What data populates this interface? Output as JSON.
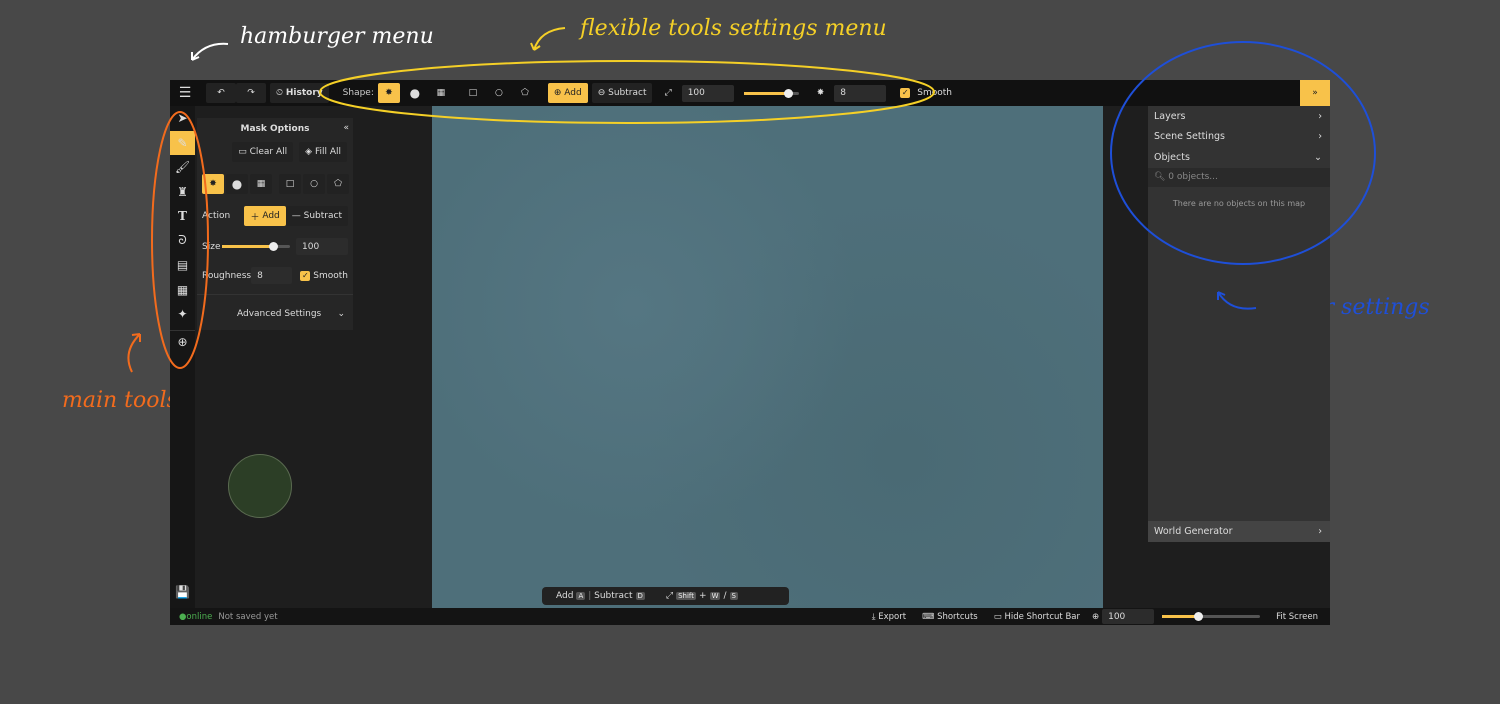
{
  "annotations": {
    "hamburger": "hamburger menu",
    "flexible": "flexible tools settings menu",
    "main_tools": "main tools menu",
    "layer": "layer settings"
  },
  "colors": {
    "accent": "#f8c24a",
    "map": "#4e6f7a",
    "annotation_yellow": "#f5d027",
    "annotation_orange": "#f26b1d",
    "annotation_blue": "#1e4fd8",
    "online": "#4caf50"
  },
  "topbar": {
    "history": "History",
    "shape_label": "Shape:",
    "add": "Add",
    "subtract": "Subtract",
    "size_value": "100",
    "size_fraction": 0.8,
    "roughness_value": "8",
    "smooth": "Smooth"
  },
  "mask": {
    "title": "Mask Options",
    "clear_all": "Clear All",
    "fill_all": "Fill All",
    "action": "Action",
    "add": "Add",
    "subtract": "Subtract",
    "size": "Size",
    "size_value": "100",
    "roughness": "Roughness",
    "roughness_value": "8",
    "smooth": "Smooth",
    "advanced": "Advanced Settings"
  },
  "right": {
    "layers": "Layers",
    "scene": "Scene Settings",
    "objects": "Objects",
    "search_placeholder": "0 objects...",
    "empty": "There are no objects on this map",
    "world": "World Generator"
  },
  "shortcut_bar": {
    "add": "Add",
    "add_key": "A",
    "subtract": "Subtract",
    "subtract_key": "D",
    "shift": "Shift",
    "w": "W",
    "s": "S"
  },
  "status": {
    "online": "online",
    "saved": "Not saved yet",
    "export": "Export",
    "shortcuts": "Shortcuts",
    "hide": "Hide Shortcut Bar",
    "zoom": "100",
    "zoom_fraction": 0.37,
    "fit": "Fit Screen"
  }
}
